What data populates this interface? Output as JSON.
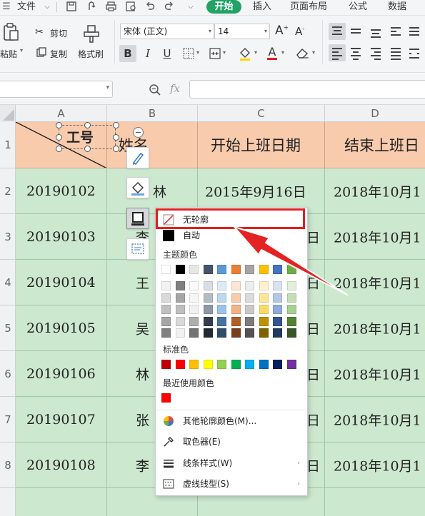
{
  "menubar": {
    "file": "文件",
    "tabs": [
      "开始",
      "插入",
      "页面布局",
      "公式",
      "数据"
    ]
  },
  "ribbon": {
    "paste": "粘贴",
    "cut": "剪切",
    "copy": "复制",
    "format_painter": "格式刷",
    "font_name": "宋体 (正文)",
    "font_size": "14",
    "bold": "B",
    "italic": "I",
    "underline": "U"
  },
  "formula_bar": {
    "fx": "fx"
  },
  "sheet": {
    "columns": [
      "A",
      "B",
      "C",
      "D"
    ],
    "rows": [
      "1",
      "2",
      "3",
      "4",
      "5",
      "6",
      "7",
      "8"
    ],
    "header": {
      "a": "工号",
      "b": "姓名",
      "c": "开始上班日期",
      "d": "结束上班日"
    },
    "data": [
      {
        "a": "20190102",
        "b": "林",
        "c": "2015年9月16日",
        "d": "2018年10月1"
      },
      {
        "a": "20190103",
        "b": "李",
        "c": "日",
        "d": "2018年10月1"
      },
      {
        "a": "20190104",
        "b": "王",
        "c": "日",
        "d": "2018年10月1"
      },
      {
        "a": "20190105",
        "b": "吴",
        "c": "日",
        "d": "2018年10月1"
      },
      {
        "a": "20190106",
        "b": "林",
        "c": "日",
        "d": "2018年10月1"
      },
      {
        "a": "20190107",
        "b": "张",
        "c": "日",
        "d": "2018年10月1"
      },
      {
        "a": "20190108",
        "b": "李",
        "c": "日",
        "d": "2018年10月1"
      }
    ]
  },
  "dropdown": {
    "no_outline": "无轮廓",
    "auto": "自动",
    "theme_colors": "主题颜色",
    "standard_colors": "标准色",
    "recent_colors": "最近使用颜色",
    "more_colors": "其他轮廓颜色(M)...",
    "eyedropper": "取色器(E)",
    "line_style": "线条样式(W)",
    "dash_style": "虚线线型(S)"
  },
  "colors": {
    "accent_green": "#21a366",
    "header_fill": "#f8cbad",
    "body_fill": "#cce8cf",
    "highlight_red": "#e02020",
    "theme_row": [
      "#ffffff",
      "#000000",
      "#e7e6e6",
      "#44546a",
      "#5b9bd5",
      "#ed7d31",
      "#a5a5a5",
      "#ffc000",
      "#4472c4",
      "#70ad47"
    ],
    "standard_row": [
      "#c00000",
      "#ff0000",
      "#ffc000",
      "#ffff00",
      "#92d050",
      "#00b050",
      "#00b0f0",
      "#0070c0",
      "#002060",
      "#7030a0"
    ],
    "recent_row": [
      "#ff0000"
    ]
  }
}
